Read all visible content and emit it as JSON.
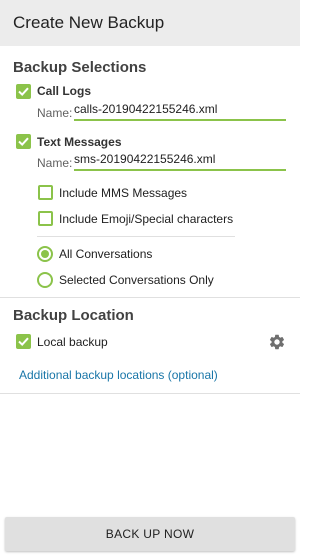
{
  "header": {
    "title": "Create New Backup"
  },
  "backup_selections": {
    "title": "Backup Selections",
    "call_logs": {
      "label": "Call Logs",
      "checked": true,
      "name_label": "Name:",
      "file_name": "calls-20190422155246.xml"
    },
    "text_messages": {
      "label": "Text Messages",
      "checked": true,
      "name_label": "Name:",
      "file_name": "sms-20190422155246.xml"
    },
    "options": [
      {
        "label": "Include MMS Messages",
        "checked": false
      },
      {
        "label": "Include Emoji/Special characters",
        "checked": false
      }
    ],
    "radios": [
      {
        "label": "All Conversations",
        "selected": true
      },
      {
        "label": "Selected Conversations Only",
        "selected": false
      }
    ]
  },
  "backup_location": {
    "title": "Backup Location",
    "local_backup": {
      "label": "Local backup",
      "checked": true
    },
    "settings_icon": "gear-icon",
    "additional_link": "Additional backup locations (optional)"
  },
  "footer": {
    "button_label": "BACK UP NOW"
  },
  "colors": {
    "accent": "#8bc34a",
    "link": "#1976a8",
    "header_bg": "#ececec"
  }
}
